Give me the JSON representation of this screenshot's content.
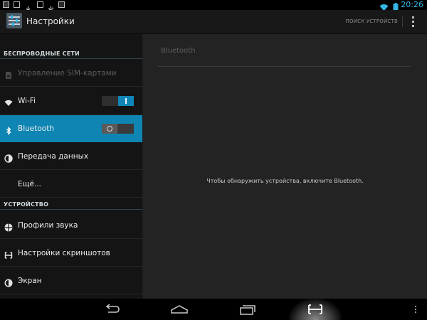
{
  "status_bar": {
    "time": "20:26",
    "notification_icons": [
      "gallery-icon",
      "image-icon",
      "download-icon",
      "checkbox-icon",
      "usb-icon",
      "screenshot-icon"
    ],
    "system_icons": [
      "wifi-icon",
      "battery-icon"
    ],
    "accent_color": "#33b5e5"
  },
  "action_bar": {
    "title": "Настройки",
    "search_button": "ПОИСК УСТРОЙСТВ",
    "overflow_icon": "overflow-menu-icon"
  },
  "sidebar": {
    "sections": [
      {
        "header": "БЕСПРОВОДНЫЕ СЕТИ",
        "items": [
          {
            "label": "Управление SIM-картами",
            "icon": "sim-icon",
            "disabled": true
          },
          {
            "label": "Wi-Fi",
            "icon": "wifi-icon",
            "switch": "on"
          },
          {
            "label": "Bluetooth",
            "icon": "bluetooth-icon",
            "switch": "off",
            "selected": true
          },
          {
            "label": "Передача данных",
            "icon": "data-usage-icon"
          },
          {
            "label": "Ещё...",
            "icon": ""
          }
        ]
      },
      {
        "header": "УСТРОЙСТВО",
        "items": [
          {
            "label": "Профили звука",
            "icon": "sound-profile-icon"
          },
          {
            "label": "Настройки скриншотов",
            "icon": "screenshot-settings-icon"
          },
          {
            "label": "Экран",
            "icon": "display-icon"
          }
        ]
      }
    ],
    "selected_color": "#0e85b3"
  },
  "detail": {
    "title": "Bluetooth",
    "message": "Чтобы обнаружить устройства, включите Bluetooth."
  },
  "nav_bar": {
    "buttons": [
      "back-icon",
      "home-icon",
      "recent-apps-icon",
      "screenshot-icon",
      "menu-icon"
    ]
  }
}
